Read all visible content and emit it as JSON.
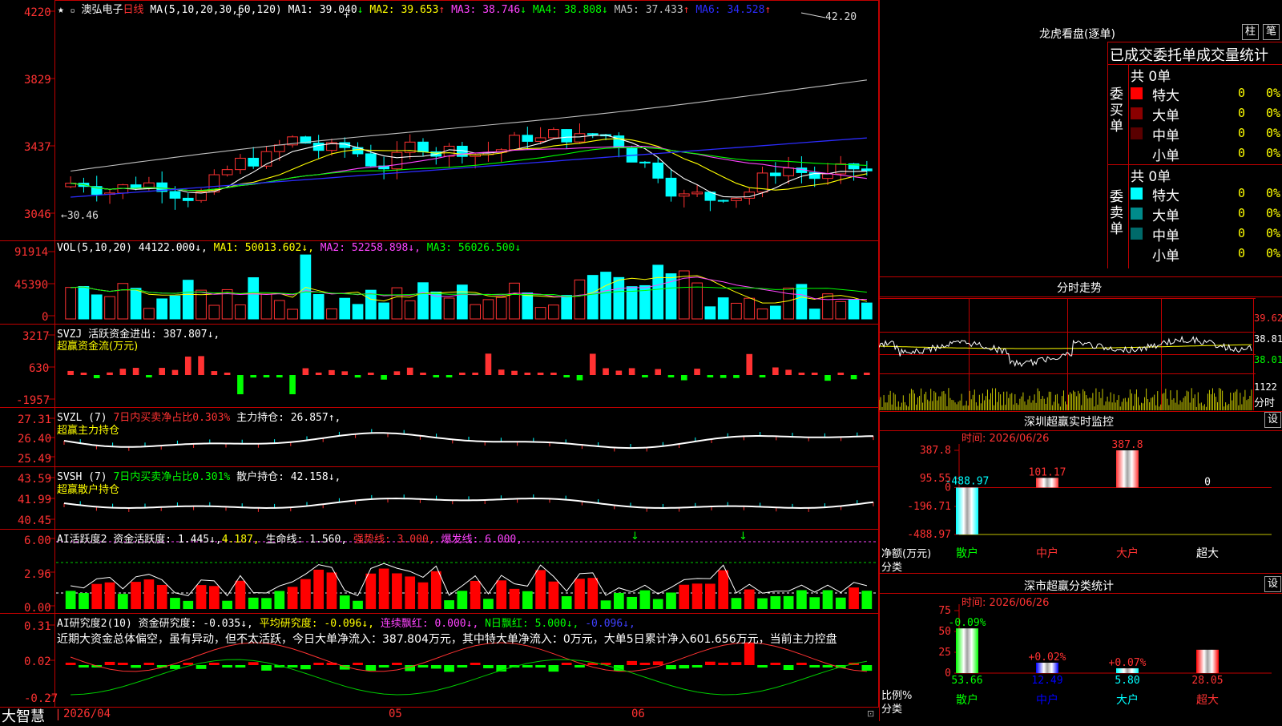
{
  "main": {
    "stock_name": "澳弘电子",
    "period": "日线",
    "ma_label": "MA(5,10,20,30,60,120)",
    "ma": [
      {
        "name": "MA1:",
        "value": "39.040",
        "arrow": "↓",
        "color": "#ffffff"
      },
      {
        "name": "MA2:",
        "value": "39.653",
        "arrow": "↑",
        "color": "#ffff00"
      },
      {
        "name": "MA3:",
        "value": "38.746",
        "arrow": "↓",
        "color": "#ff44ff"
      },
      {
        "name": "MA4:",
        "value": "38.808",
        "arrow": "↓",
        "color": "#00ff00"
      },
      {
        "name": "MA5:",
        "value": "37.433",
        "arrow": "↑",
        "color": "#c0c0c0"
      },
      {
        "name": "MA6:",
        "value": "34.528",
        "arrow": "↑",
        "color": "#2c2cff"
      }
    ],
    "y_ticks": [
      "4220",
      "3829",
      "3437",
      "3046"
    ],
    "high_label": "42.20",
    "low_label": "←30.46"
  },
  "vol": {
    "label": "VOL(5,10,20)",
    "items": [
      {
        "text": "44122.000↓,",
        "color": "#ffffff"
      },
      {
        "text": "MA1: 50013.602↓,",
        "color": "#ffff00"
      },
      {
        "text": "MA2: 52258.898↓,",
        "color": "#ff44ff"
      },
      {
        "text": "MA3: 56026.500↓",
        "color": "#00ff00"
      }
    ],
    "y_ticks": [
      "91914",
      "45390",
      "0"
    ]
  },
  "svzj": {
    "line1": "SVZJ  活跃资金进出: 387.807↓,",
    "line2": "超赢资金流(万元)",
    "y_ticks": [
      "3217",
      "630",
      "-1957"
    ]
  },
  "svzl": {
    "prefix": "SVZL (7)",
    "mid": "7日内买卖净占比0.303%",
    "tail": "主力持仓: 26.857↑,",
    "line2": "超赢主力持仓",
    "y_ticks": [
      "27.31",
      "26.40",
      "25.49"
    ]
  },
  "svsh": {
    "prefix": "SVSH (7)",
    "mid": "7日内买卖净占比0.301%",
    "tail": "散户持仓: 42.158↓,",
    "line2": "超赢散户持仓",
    "y_ticks": [
      "43.59",
      "41.99",
      "40.45"
    ]
  },
  "ai2": {
    "a": "AI活跃度2 资金活跃度: 1.445↓,",
    "b": "4.187,",
    "c": "生命线: 1.560,",
    "d": "强势线: 3.000,",
    "e": "爆发线: 6.000,",
    "y_ticks": [
      "6.00",
      "2.96",
      "0.00"
    ]
  },
  "ai3": {
    "a": "AI研究度2(10) 资金研究度: -0.035↓,",
    "b": "平均研究度: -0.096↓,",
    "c": "连续飘红: 0.000↓,",
    "d": "N日飘红: 5.000↓,",
    "e": "-0.096↓,",
    "comment": "近期大资金总体偏空，虽有异动，但不太活跃，今日大单净流入：387.804万元，其中特大单净流入：0万元，大单5日累计净入601.656万元，当前主力控盘",
    "y_ticks": [
      "0.31",
      "0.02",
      "-0.27"
    ]
  },
  "bottom": {
    "brand": "大智慧",
    "dates": [
      "2026/04",
      "05",
      "06"
    ]
  },
  "right": {
    "dragon_title": "龙虎看盘(逐单)",
    "btn_bar": "柱",
    "btn_pen": "笔",
    "tabs": "已成交委托单成交量统计",
    "buy_label": "委买单",
    "sell_label": "委卖单",
    "buy_total": "共 0单",
    "sell_total": "共 0单",
    "buy_rows": [
      {
        "name": "特大",
        "count": "0",
        "pct": "0%",
        "color": "#ff0000"
      },
      {
        "name": "大单",
        "count": "0",
        "pct": "0%",
        "color": "#8b0000"
      },
      {
        "name": "中单",
        "count": "0",
        "pct": "0%",
        "color": "#5a0000"
      },
      {
        "name": "小单",
        "count": "0",
        "pct": "0%",
        "color": ""
      }
    ],
    "sell_rows": [
      {
        "name": "特大",
        "count": "0",
        "pct": "0%",
        "color": "#00ffff"
      },
      {
        "name": "大单",
        "count": "0",
        "pct": "0%",
        "color": "#008b8b"
      },
      {
        "name": "中单",
        "count": "0",
        "pct": "0%",
        "color": "#006a6a"
      },
      {
        "name": "小单",
        "count": "0",
        "pct": "0%",
        "color": ""
      }
    ],
    "intraday_title": "分时走势",
    "intraday_ticks": [
      "39.62",
      "38.81",
      "38.01",
      "1122",
      "分时"
    ],
    "monitor_title": "深圳超赢实时监控",
    "monitor_time": "时间: 2026/06/26",
    "monitor_btn": "设",
    "monitor_yticks": [
      "387.8",
      "95.55",
      "0",
      "-196.71",
      "-488.97"
    ],
    "monitor_ylabel": "净额(万元)",
    "monitor_xlabel": "分类",
    "class_title": "深市超赢分类统计",
    "class_time": "时间: 2026/06/26",
    "class_yticks": [
      "75",
      "50",
      "25",
      "0"
    ],
    "class_ylabel": "比例%",
    "class_xlabel": "分类"
  },
  "chart_data": [
    {
      "type": "bar",
      "title": "深圳超赢实时监控",
      "ylabel": "净额(万元)",
      "categories": [
        "散户",
        "中户",
        "大户",
        "超大"
      ],
      "values": [
        -488.97,
        101.17,
        387.8,
        0
      ],
      "labels": [
        "-488.97",
        "101.17",
        "387.8",
        "0"
      ],
      "colors": [
        "#00ffff",
        "#ff3232",
        "#ff3232",
        "#ffffff"
      ],
      "cat_colors": [
        "#00ff00",
        "#ff3232",
        "#ff3232",
        "#ffffff"
      ],
      "ylim": [
        -488.97,
        387.8
      ]
    },
    {
      "type": "bar",
      "title": "深市超赢分类统计",
      "ylabel": "比例%",
      "categories": [
        "散户",
        "中户",
        "大户",
        "超大"
      ],
      "values": [
        53.66,
        12.49,
        5.8,
        28.05
      ],
      "labels": [
        "53.66",
        "12.49",
        "5.80",
        "28.05"
      ],
      "changes": [
        "-0.09%",
        "+0.02%",
        "+0.07%",
        ""
      ],
      "colors": [
        "#00ff00",
        "#0000ff",
        "#00ffff",
        "#ff0000"
      ],
      "cat_colors": [
        "#00ff00",
        "#0000ff",
        "#00ffff",
        "#ff3232"
      ],
      "ylim": [
        0,
        75
      ]
    },
    {
      "type": "line",
      "title": "澳弘电子 日线",
      "x": [
        "2026/04",
        "05",
        "06"
      ],
      "ylim": [
        30.46,
        42.2
      ],
      "series": [
        {
          "name": "MA1",
          "last": 39.04
        },
        {
          "name": "MA2",
          "last": 39.653
        },
        {
          "name": "MA3",
          "last": 38.746
        },
        {
          "name": "MA4",
          "last": 38.808
        },
        {
          "name": "MA5",
          "last": 37.433
        },
        {
          "name": "MA6",
          "last": 34.528
        }
      ]
    }
  ]
}
